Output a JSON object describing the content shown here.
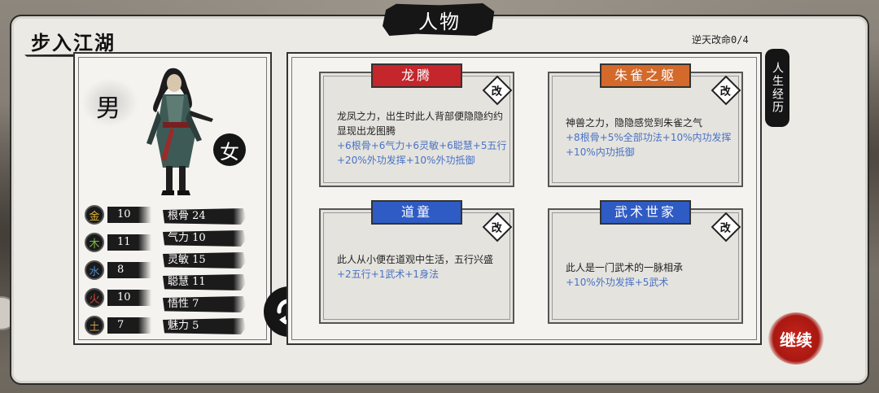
{
  "header": {
    "screen_title": "人物",
    "section_title": "步入江湖",
    "fate_label": "逆天改命0/4"
  },
  "gender": {
    "male": "男",
    "female": "女"
  },
  "elements": [
    {
      "glyph": "金",
      "value": "10",
      "color": "#e0b43a"
    },
    {
      "glyph": "木",
      "value": "11",
      "color": "#7fb84a"
    },
    {
      "glyph": "水",
      "value": "8",
      "color": "#4a8fd0"
    },
    {
      "glyph": "火",
      "value": "10",
      "color": "#d0483a"
    },
    {
      "glyph": "土",
      "value": "7",
      "color": "#c89a52"
    }
  ],
  "stats": [
    {
      "label": "根骨 24"
    },
    {
      "label": "气力 10"
    },
    {
      "label": "灵敏 15"
    },
    {
      "label": "聪慧 11"
    },
    {
      "label": "悟性 7"
    },
    {
      "label": "魅力 5"
    }
  ],
  "side_tab": "人生经历",
  "change_label": "改",
  "cards": [
    {
      "title": "龙腾",
      "title_color": "#c4262c",
      "desc": "龙凤之力，出生时此人背部便隐隐约约显现出龙图腾",
      "bonus": "+6根骨+6气力+6灵敏+6聪慧+5五行+20%外功发挥+10%外功抵御"
    },
    {
      "title": "朱雀之躯",
      "title_color": "#d3692a",
      "desc": "神兽之力，隐隐感觉到朱雀之气",
      "bonus": "+8根骨+5%全部功法+10%内功发挥+10%内功抵御"
    },
    {
      "title": "道童",
      "title_color": "#2f5bc4",
      "desc": "此人从小便在道观中生活，五行兴盛",
      "bonus": "+2五行+1武术+1身法"
    },
    {
      "title": "武术世家",
      "title_color": "#2f5bc4",
      "desc": "此人是一门武术的一脉相承",
      "bonus": "+10%外功发挥+5武术"
    }
  ],
  "continue_label": "继续"
}
